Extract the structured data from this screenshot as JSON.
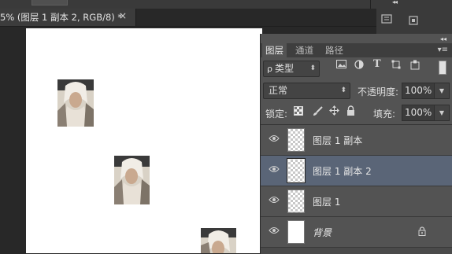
{
  "document_tab": {
    "title": "5% (图层 1 副本 2, RGB/8) *",
    "close_glyph": "×"
  },
  "panel": {
    "collapse_glyph": "◂◂",
    "tabs": [
      {
        "label": "图层",
        "active": true
      },
      {
        "label": "通道",
        "active": false
      },
      {
        "label": "路径",
        "active": false
      }
    ],
    "menu_glyph": "▾≡",
    "filter": {
      "search_glyph": "ρ",
      "label": "类型"
    },
    "filter_icons": [
      "image-filter-icon",
      "adjustment-filter-icon",
      "text-filter-icon",
      "shape-filter-icon",
      "smart-object-filter-icon"
    ],
    "blend_mode": "正常",
    "opacity_label": "不透明度:",
    "opacity_value": "100%",
    "lock_label": "锁定:",
    "fill_label": "填充:",
    "fill_value": "100%",
    "layers": [
      {
        "name": "图层 1 副本",
        "thumb": "transparent",
        "selected": false,
        "locked": false
      },
      {
        "name": "图层 1 副本 2",
        "thumb": "transparent",
        "selected": true,
        "locked": false
      },
      {
        "name": "图层 1",
        "thumb": "transparent",
        "selected": false,
        "locked": false
      },
      {
        "name": "背景",
        "thumb": "white",
        "selected": false,
        "locked": true
      }
    ]
  },
  "colors": {
    "panel_bg": "#535353",
    "selected_layer": "#5a6577",
    "canvas": "#ffffff",
    "workspace": "#282828"
  }
}
